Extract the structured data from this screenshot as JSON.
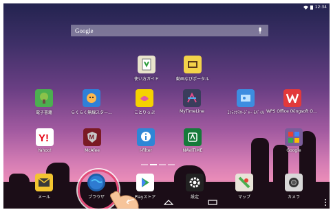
{
  "status": {
    "time": "12:34"
  },
  "search": {
    "placeholder": "Google"
  },
  "apps": {
    "row1": [
      {
        "label": "使い方ガイド"
      },
      {
        "label": "動画なびポータル"
      }
    ],
    "row2": [
      {
        "label": "電子書籍"
      },
      {
        "label": "らくらく無線スター..."
      },
      {
        "label": "ことりっぷ"
      },
      {
        "label": "MyTimeLine"
      },
      {
        "label": "ｺﾝﾃﾝﾂﾏﾈｰｼﾞｬｰ ﾓﾊﾞｲﾙ"
      },
      {
        "label": "WPS Office (Kingsoft Offi..."
      }
    ],
    "row3": [
      {
        "label": "Yahoo!"
      },
      {
        "label": "McAfee"
      },
      {
        "label": "i-filter"
      },
      {
        "label": "NAVITIME"
      },
      {
        "label": "Google"
      }
    ]
  },
  "dock": [
    {
      "label": "メール"
    },
    {
      "label": "ブラウザ"
    },
    {
      "label": "Playストア"
    },
    {
      "label": "設定"
    },
    {
      "label": "マップ"
    },
    {
      "label": "カメラ"
    }
  ],
  "colors": {
    "ring": "#e24b78"
  }
}
